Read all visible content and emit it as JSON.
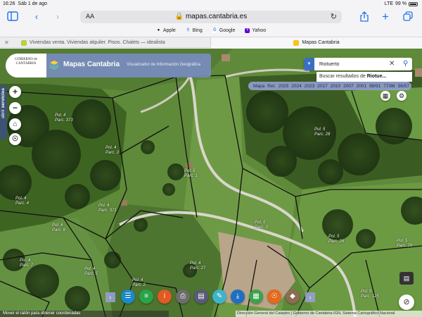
{
  "status": {
    "time": "16:26",
    "date": "Sáb 1 de ago",
    "carrier": "LTE",
    "battery": "99 %"
  },
  "browser": {
    "text_size_label": "AA",
    "url": "mapas.cantabria.es",
    "favorites": [
      {
        "label": "Apple",
        "icon": "apple-icon"
      },
      {
        "label": "Bing",
        "icon": "search-icon"
      },
      {
        "label": "Google",
        "icon": "google-icon"
      },
      {
        "label": "Yahoo",
        "icon": "yahoo-icon"
      }
    ],
    "tabs": [
      {
        "label": "Viviendas venta. Viviendas alquiler. Pisos. Chalets — idealista",
        "active": false
      },
      {
        "label": "Mapas Cantabria",
        "active": true
      }
    ]
  },
  "app": {
    "logo_text": "GOBIERNO de CANTABRIA",
    "title": "Mapas Cantabria",
    "subtitle": "Visualizador de Información Geográfica",
    "search": {
      "value": "Riotuerto",
      "suggestion_prefix": "Buscar resultados de ",
      "suggestion_term": "Riotue..."
    },
    "timeline": [
      "Mapa",
      "Rel.",
      "2025",
      "2024",
      "2023",
      "2017",
      "2010",
      "2007",
      "2001",
      "88/91",
      "77/86",
      "56/57"
    ],
    "left_panel_label_prefix": "abrir",
    "left_panel_label": "servicios",
    "coords_hint": "Mover el ratón para obtener coordenadas",
    "attribution": "Dirección General del Catastro | Gobierno de Cantabria-IGN, Sistema Cartográfico Nacional",
    "accent_color": "#2a62b8"
  },
  "parcels": [
    {
      "pol": "Pol. 4",
      "parc": "Parc. 373"
    },
    {
      "pol": "Pol. 4",
      "parc": "Parc. 2"
    },
    {
      "pol": "Pol. 4",
      "parc": "Parc. 4"
    },
    {
      "pol": "Pol. 5",
      "parc": "Parc. 1"
    },
    {
      "pol": "Pol. 5",
      "parc": "Parc. 28"
    },
    {
      "pol": "Pol. 4",
      "parc": "Parc. 371"
    },
    {
      "pol": "Pol. 4",
      "parc": "Parc. 6"
    },
    {
      "pol": "Pol. 4",
      "parc": "Parc. 7"
    },
    {
      "pol": "Pol. 4",
      "parc": "Parc. 5"
    },
    {
      "pol": "Pol. 4",
      "parc": "Parc. 27"
    },
    {
      "pol": "Pol. 5",
      "parc": "Parc. 2"
    },
    {
      "pol": "Pol. 5",
      "parc": "Parc. 26"
    },
    {
      "pol": "Pol. 5",
      "parc": "Parc. 29"
    },
    {
      "pol": "Pol. 5",
      "parc": "Parc. 125"
    },
    {
      "pol": "Pol. 4",
      "parc": "Parc. 2"
    }
  ]
}
